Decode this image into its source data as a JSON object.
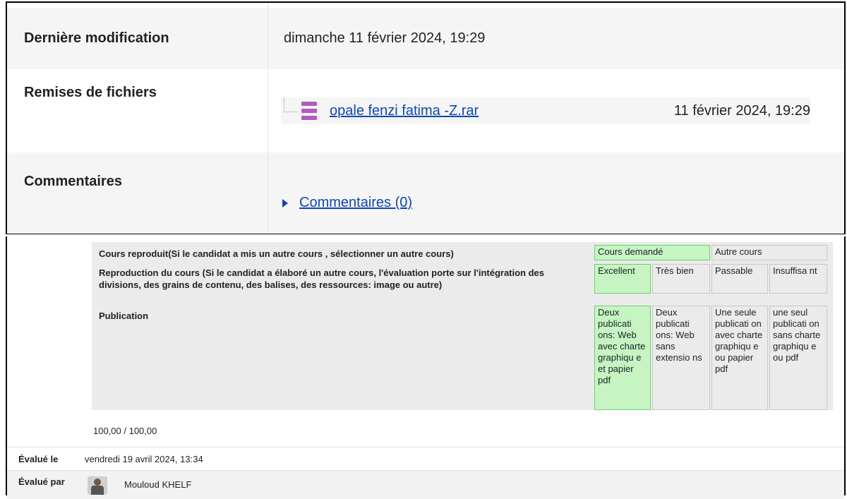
{
  "submission": {
    "last_modified_label": "Dernière modification",
    "last_modified_value": "dimanche 11 février 2024, 19:29",
    "files_label": "Remises de fichiers",
    "file_name": "opale fenzi fatima -Z.rar",
    "file_date": "11 février 2024, 19:29",
    "comments_label": "Commentaires",
    "comments_link": "Commentaires (0)"
  },
  "rubric": {
    "criteria": [
      {
        "description": "Cours reproduit(Si le candidat a mis un autre cours , sélectionner un autre cours)",
        "levels": [
          "Cours demandé",
          "Autre cours"
        ],
        "selected": 0
      },
      {
        "description": "Reproduction du cours (Si le candidat a élaboré un autre cours, l'évaluation porte sur l'intégration des divisions, des grains de contenu, des balises, des ressources: image ou autre)",
        "levels": [
          "Excellent",
          "Très bien",
          "Passable",
          "Insuffisa nt"
        ],
        "selected": 0
      },
      {
        "description": "Publication",
        "levels": [
          "Deux publicati ons: Web avec charte graphiqu e et papier pdf",
          "Deux publicati ons: Web sans extensio ns",
          "Une seule publicati on avec charte graphiqu e ou papier pdf",
          "une seul publicati on sans charte graphiqu e ou pdf"
        ],
        "selected": 0
      }
    ],
    "score": "100,00 / 100,00"
  },
  "grading": {
    "graded_on_label": "Évalué le",
    "graded_on_value": "vendredi 19 avril 2024, 13:34",
    "graded_by_label": "Évalué par",
    "graded_by_value": "Mouloud KHELF"
  },
  "colors": {
    "link": "#0f47ad",
    "selected_level": "#c6f5c3",
    "row_shade": "#f5f5f5",
    "rar_icon": "#b05cc0"
  }
}
